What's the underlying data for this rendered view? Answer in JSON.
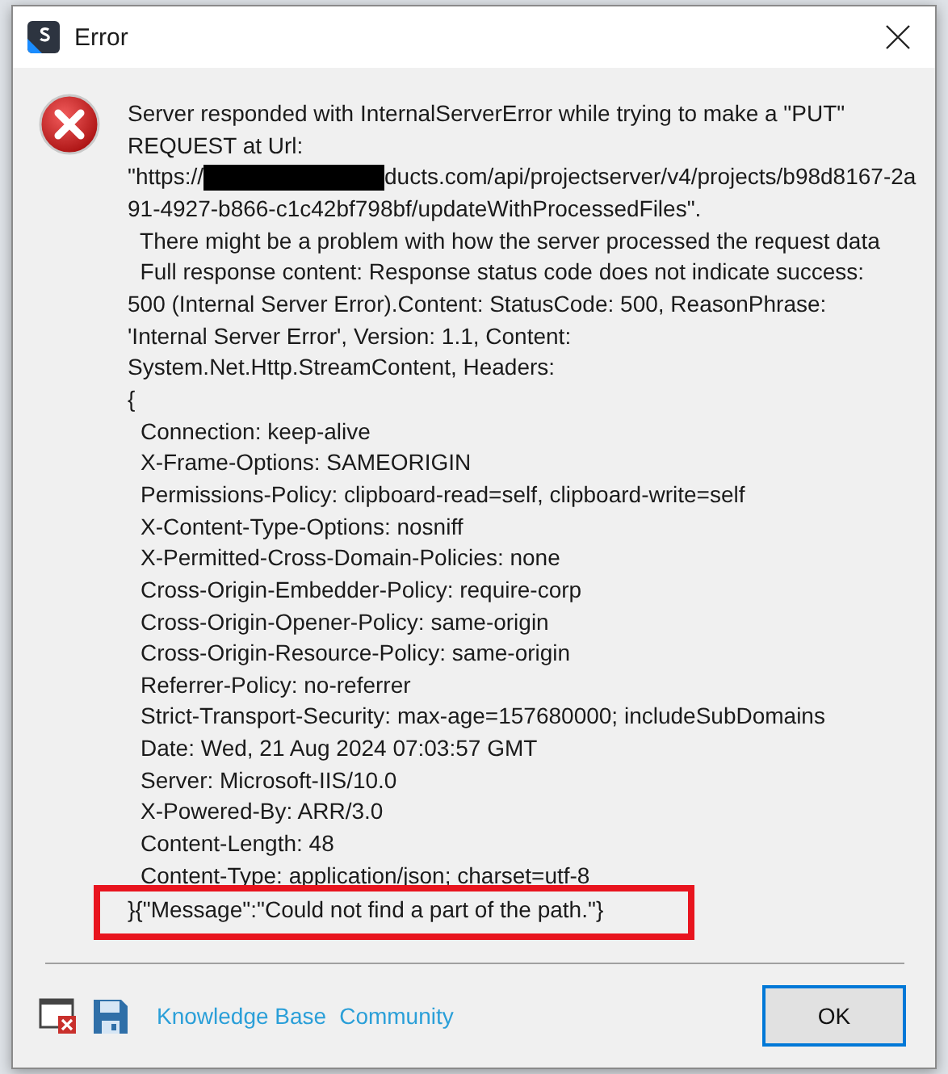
{
  "window": {
    "title": "Error"
  },
  "message": {
    "lines": [
      "Server responded with InternalServerError while trying to make a \"PUT\"",
      "REQUEST at Url:"
    ],
    "url": {
      "before": "\"https://",
      "after": "ducts.com/api/projectserver/v4/projects/b98d8167-2a"
    },
    "continued": [
      "91-4927-b866-c1c42bf798bf/updateWithProcessedFiles\".",
      "  There might be a problem with how the server processed the request data",
      "  Full response content: Response status code does not indicate success:",
      "500 (Internal Server Error).Content: StatusCode: 500, ReasonPhrase:",
      "'Internal Server Error', Version: 1.1, Content:",
      "System.Net.Http.StreamContent, Headers:",
      "{"
    ]
  },
  "headers": [
    "Connection: keep-alive",
    "X-Frame-Options: SAMEORIGIN",
    "Permissions-Policy: clipboard-read=self, clipboard-write=self",
    "X-Content-Type-Options: nosniff",
    "X-Permitted-Cross-Domain-Policies: none",
    "Cross-Origin-Embedder-Policy: require-corp",
    "Cross-Origin-Opener-Policy: same-origin",
    "Cross-Origin-Resource-Policy: same-origin",
    "Referrer-Policy: no-referrer",
    "Strict-Transport-Security: max-age=157680000; includeSubDomains",
    "Date: Wed, 21 Aug 2024 07:03:57 GMT",
    "Server: Microsoft-IIS/10.0",
    "X-Powered-By: ARR/3.0",
    "Content-Length: 48",
    "Content-Type: application/json; charset=utf-8"
  ],
  "highlighted": "}{\"Message\":\"Could not find a part of the path.\"}",
  "footer": {
    "links": [
      "Knowledge Base",
      "Community"
    ],
    "button": "OK"
  }
}
